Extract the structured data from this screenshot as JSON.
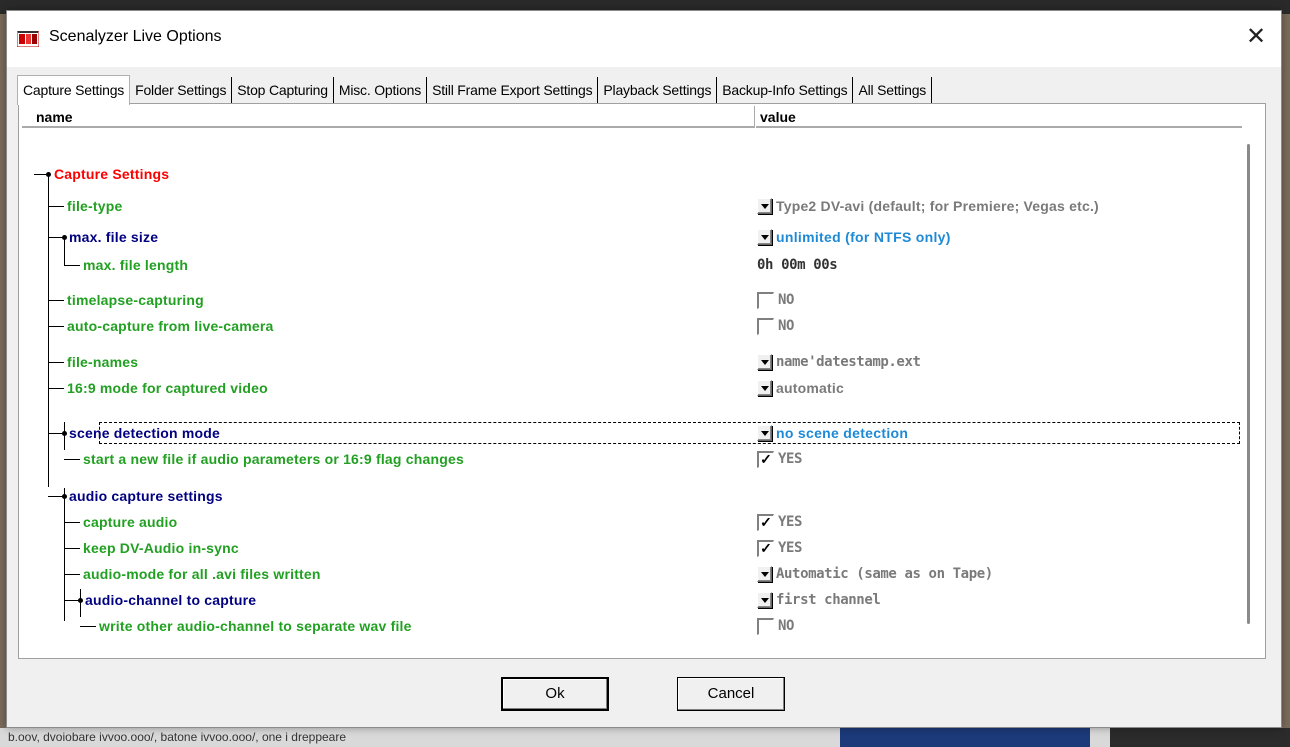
{
  "window": {
    "title": "Scenalyzer Live Options",
    "close_symbol": "✕"
  },
  "tabs": [
    {
      "label": "Capture Settings",
      "active": true
    },
    {
      "label": "Folder Settings"
    },
    {
      "label": "Stop Capturing"
    },
    {
      "label": "Misc. Options"
    },
    {
      "label": "Still Frame Export Settings"
    },
    {
      "label": "Playback Settings"
    },
    {
      "label": "Backup-Info Settings"
    },
    {
      "label": "All Settings"
    }
  ],
  "columns": {
    "name": "name",
    "value": "value"
  },
  "tree": {
    "root": "Capture Settings",
    "rows": [
      {
        "label": "file-type",
        "value": "Type2 DV-avi (default; for Premiere; Vegas etc.)",
        "control": "dropdown"
      },
      {
        "label": "max. file size",
        "value": "unlimited (for NTFS only)",
        "control": "dropdown"
      },
      {
        "label": "max. file length",
        "value": "0h 00m 00s",
        "control": "text"
      },
      {
        "label": "timelapse-capturing",
        "value": "NO",
        "control": "checkbox",
        "checked": false
      },
      {
        "label": "auto-capture from live-camera",
        "value": "NO",
        "control": "checkbox",
        "checked": false
      },
      {
        "label": "file-names",
        "value": "name'datestamp.ext",
        "control": "dropdown"
      },
      {
        "label": "16:9 mode for captured video",
        "value": "automatic",
        "control": "dropdown"
      },
      {
        "label": "scene detection mode",
        "value": "no scene detection",
        "control": "dropdown"
      },
      {
        "label": "start a new file if audio parameters or 16:9 flag changes",
        "value": "YES",
        "control": "checkbox",
        "checked": true
      },
      {
        "label": "audio capture settings"
      },
      {
        "label": "capture audio",
        "value": "YES",
        "control": "checkbox",
        "checked": true
      },
      {
        "label": "keep DV-Audio in-sync",
        "value": "YES",
        "control": "checkbox",
        "checked": true
      },
      {
        "label": "audio-mode for all .avi files written",
        "value": "Automatic (same as on Tape)",
        "control": "dropdown"
      },
      {
        "label": "audio-channel to capture",
        "value": "first channel",
        "control": "dropdown"
      },
      {
        "label": "write other audio-channel to separate wav file",
        "value": "NO",
        "control": "checkbox",
        "checked": false
      }
    ]
  },
  "buttons": {
    "ok": "Ok",
    "cancel": "Cancel"
  },
  "background": {
    "status_text": "b.oov, dvoiobare ivvoo.ooo/, batone ivvoo.ooo/, one i dreppeare"
  },
  "colors": {
    "root": "#ff0000",
    "leaf": "#22a022",
    "group": "#000080",
    "value_highlight": "#1e8ad6"
  },
  "icons": {
    "app": "app-logo-icon",
    "close": "close-icon",
    "dropdown": "dropdown-arrow-icon",
    "check": "checkmark-icon"
  }
}
